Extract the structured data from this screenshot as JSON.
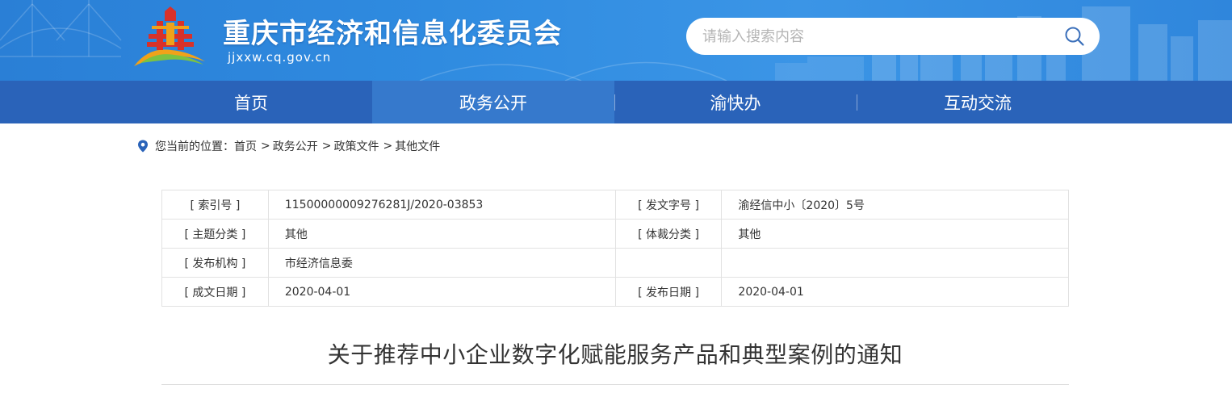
{
  "header": {
    "site_title": "重庆市经济和信息化委员会",
    "domain": "jjxxw.cq.gov.cn",
    "logo_icon": "government-building-logo-icon",
    "search": {
      "placeholder": "请输入搜索内容",
      "value": "",
      "icon": "search-icon"
    }
  },
  "nav": {
    "items": [
      {
        "label": "首页"
      },
      {
        "label": "政务公开",
        "active": true
      },
      {
        "label": "渝快办"
      },
      {
        "label": "互动交流"
      }
    ]
  },
  "breadcrumb": {
    "icon": "location-pin-icon",
    "prefix": "您当前的位置：",
    "items": [
      {
        "label": "首页"
      },
      {
        "label": "政务公开"
      },
      {
        "label": "政策文件"
      },
      {
        "label": "其他文件"
      }
    ],
    "separator": ">"
  },
  "metadata": {
    "rows": [
      {
        "label1": "[ 索引号 ]",
        "value1": "11500000009276281J/2020-03853",
        "label2": "[ 发文字号 ]",
        "value2": "渝经信中小〔2020〕5号"
      },
      {
        "label1": "[ 主题分类 ]",
        "value1": "其他",
        "label2": "[ 体裁分类 ]",
        "value2": "其他"
      },
      {
        "label1": "[ 发布机构 ]",
        "value1": "市经济信息委",
        "label2": "",
        "value2": ""
      },
      {
        "label1": "[ 成文日期 ]",
        "value1": "2020-04-01",
        "label2": "[ 发布日期 ]",
        "value2": "2020-04-01"
      }
    ]
  },
  "article": {
    "title": "关于推荐中小企业数字化赋能服务产品和典型案例的通知"
  },
  "colors": {
    "nav_bg": "#2a63b9",
    "nav_active": "#3679cc",
    "banner": "#2f8be0",
    "logo_red": "#d8312a",
    "logo_gold": "#f0a21a"
  }
}
